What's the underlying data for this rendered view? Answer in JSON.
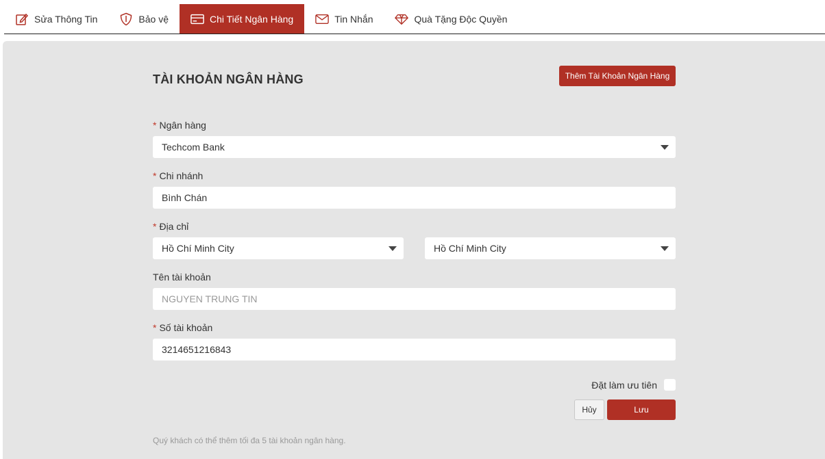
{
  "tabs": [
    {
      "label": "Sửa Thông Tin",
      "icon": "edit-icon"
    },
    {
      "label": "Bảo vệ",
      "icon": "shield-icon"
    },
    {
      "label": "Chi Tiết Ngân Hàng",
      "icon": "credit-card-icon",
      "active": true
    },
    {
      "label": "Tin Nhắn",
      "icon": "envelope-icon"
    },
    {
      "label": "Quà Tặng Độc Quyền",
      "icon": "diamond-icon"
    }
  ],
  "form": {
    "title": "TÀI KHOẢN NGÂN HÀNG",
    "add_button": "Thêm Tài Khoản Ngân Hàng",
    "bank": {
      "label": "Ngân hàng",
      "value": "Techcom Bank"
    },
    "branch": {
      "label": "Chi nhánh",
      "value": "Bình Chán"
    },
    "address": {
      "label": "Địa chỉ",
      "province": "Hồ Chí Minh City",
      "city": "Hồ Chí Minh City"
    },
    "account_name": {
      "label": "Tên tài khoản",
      "placeholder": "NGUYEN TRUNG TIN"
    },
    "account_number": {
      "label": "Số tài khoản",
      "value": "3214651216843"
    },
    "priority_label": "Đặt làm ưu tiên",
    "cancel_button": "Hủy",
    "save_button": "Lưu",
    "note": "Quý khách có thể thêm tối đa 5 tài khoản ngân hàng."
  },
  "colors": {
    "accent": "#b03025",
    "panel_bg": "#e5e5e5"
  }
}
